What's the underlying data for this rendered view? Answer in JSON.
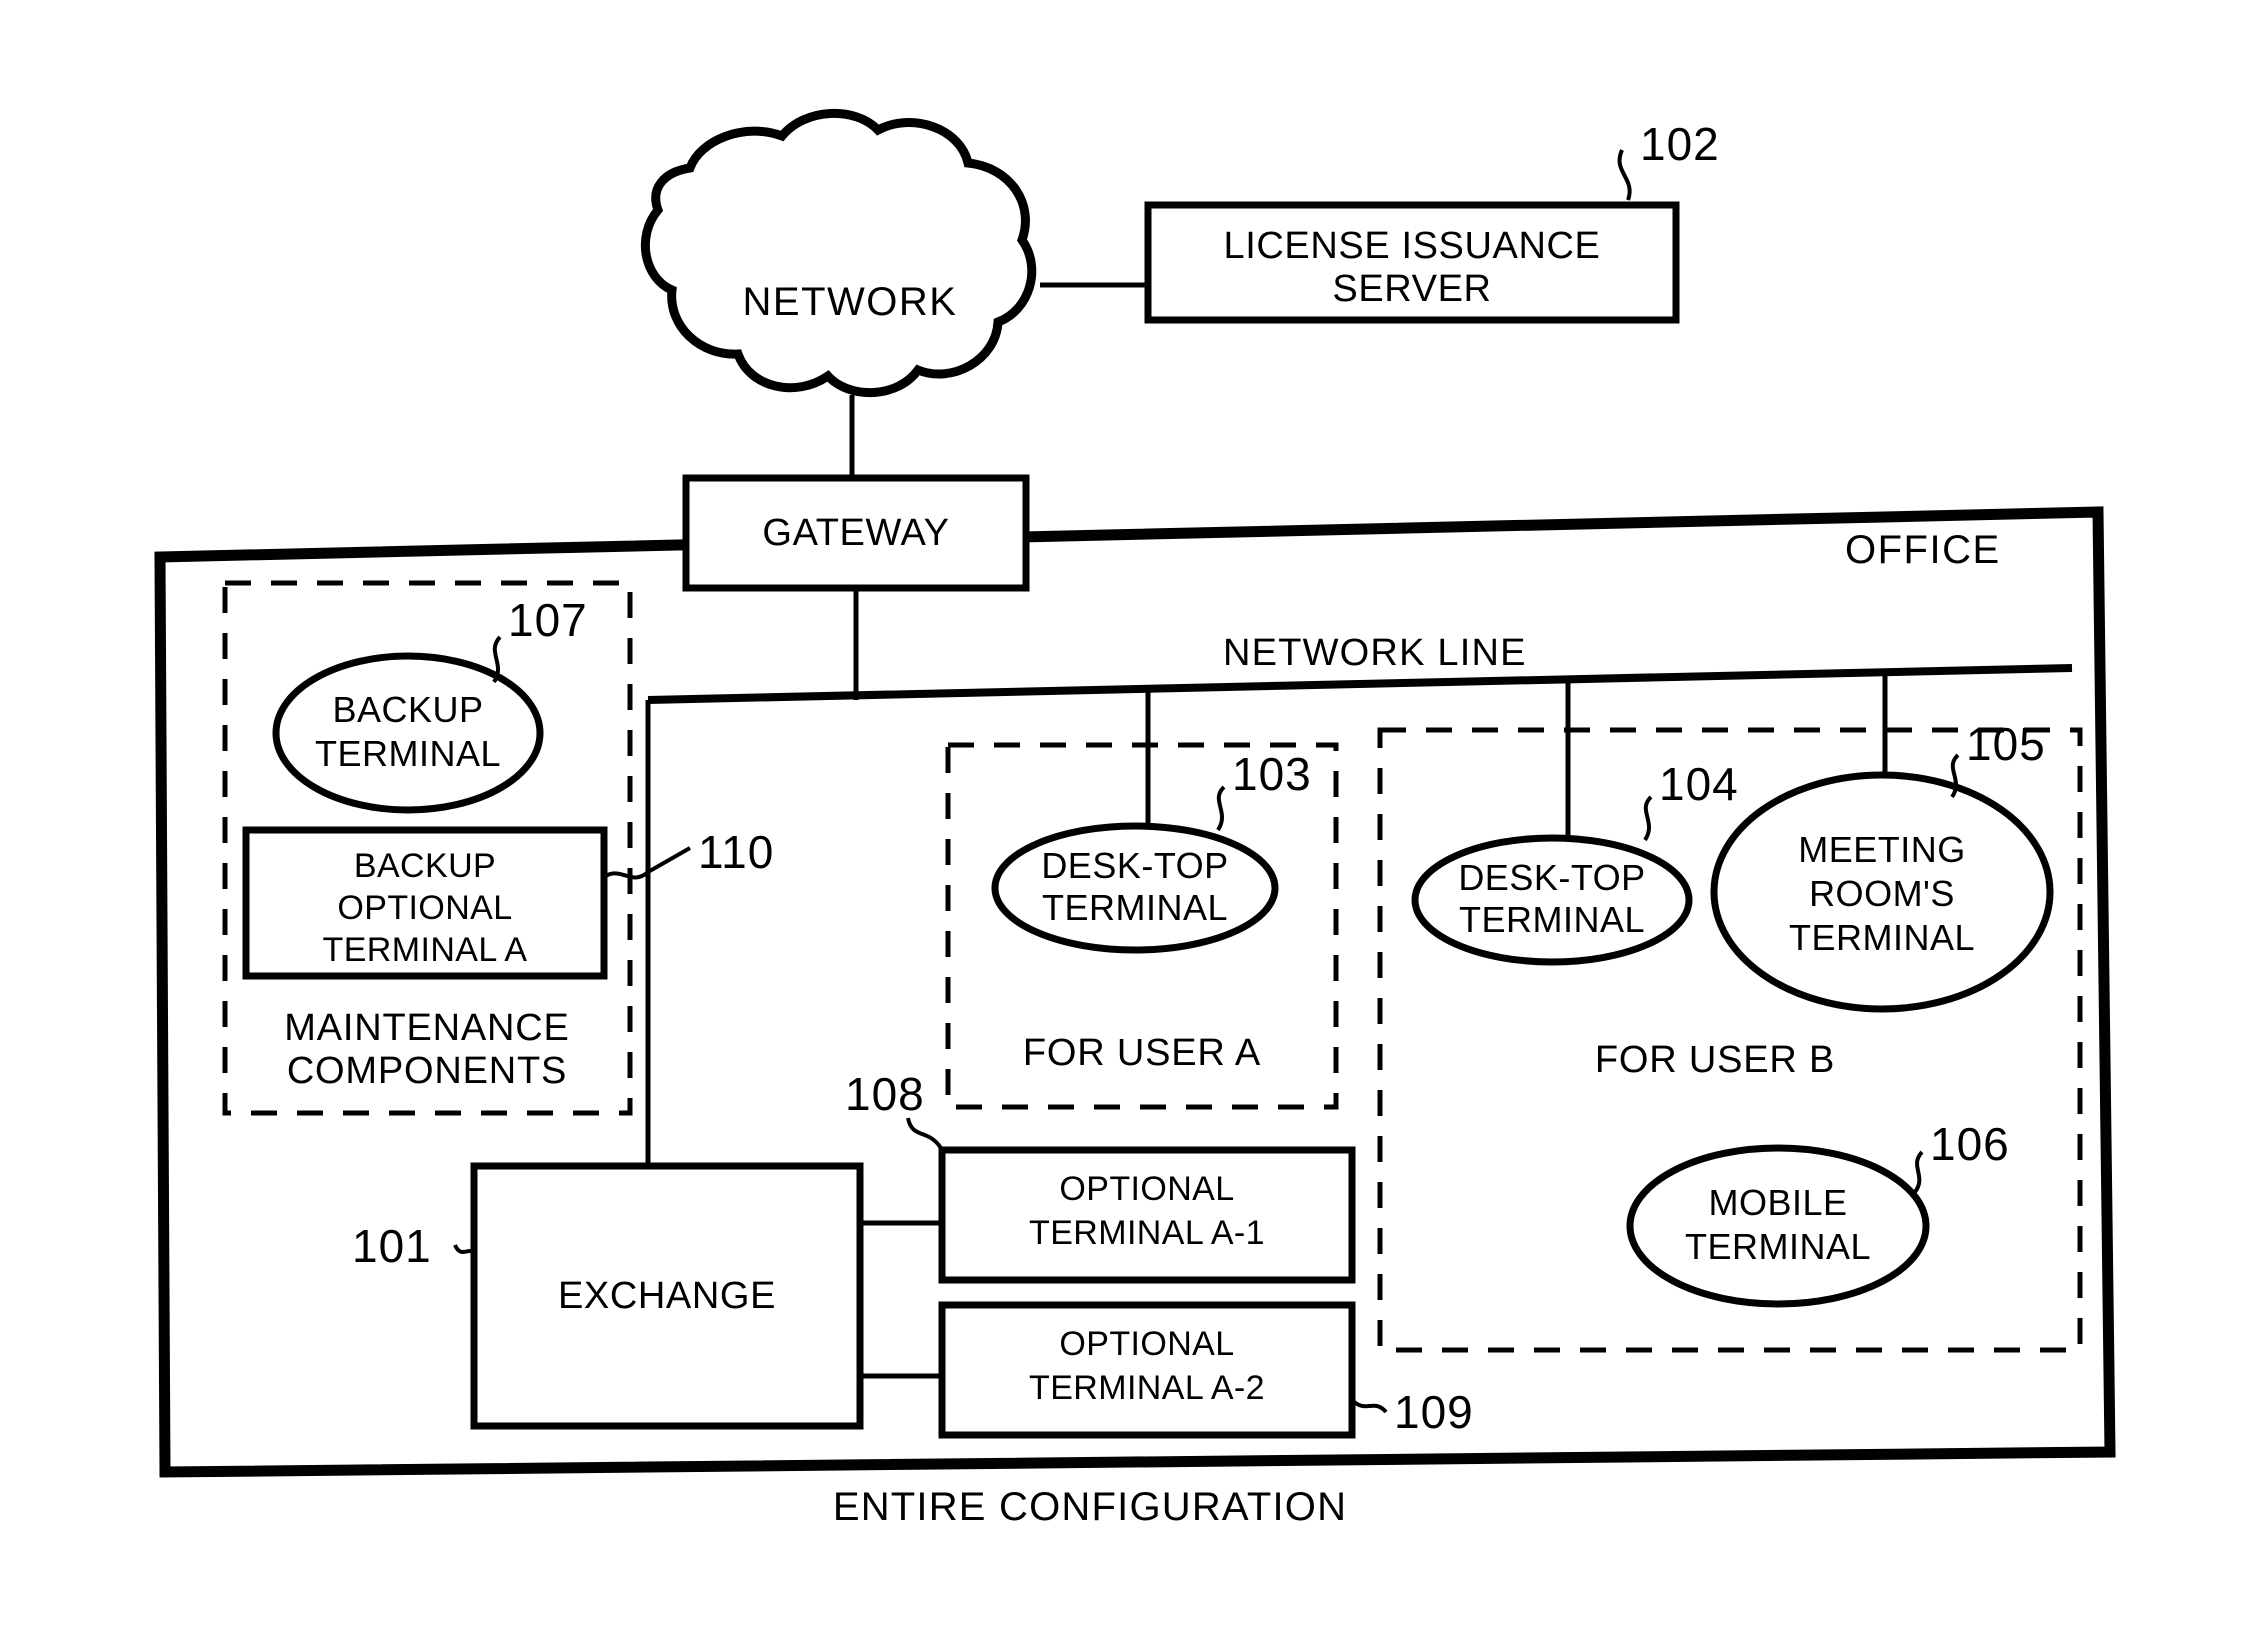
{
  "figure": {
    "caption": "ENTIRE CONFIGURATION",
    "office_label": "OFFICE",
    "network_line_label": "NETWORK LINE"
  },
  "nodes": {
    "network_cloud": {
      "label": "NETWORK"
    },
    "license_server": {
      "label_line1": "LICENSE ISSUANCE",
      "label_line2": "SERVER",
      "ref": "102"
    },
    "gateway": {
      "label": "GATEWAY"
    },
    "exchange": {
      "label": "EXCHANGE",
      "ref": "101"
    },
    "backup_terminal": {
      "label_line1": "BACKUP",
      "label_line2": "TERMINAL",
      "ref": "107"
    },
    "backup_optional_terminal_a": {
      "label_line1": "BACKUP",
      "label_line2": "OPTIONAL",
      "label_line3": "TERMINAL A",
      "ref": "110"
    },
    "desktop_terminal_a": {
      "label_line1": "DESK-TOP",
      "label_line2": "TERMINAL",
      "ref": "103"
    },
    "desktop_terminal_b": {
      "label_line1": "DESK-TOP",
      "label_line2": "TERMINAL",
      "ref": "104"
    },
    "meeting_room_terminal": {
      "label_line1": "MEETING",
      "label_line2": "ROOM'S",
      "label_line3": "TERMINAL",
      "ref": "105"
    },
    "mobile_terminal": {
      "label_line1": "MOBILE",
      "label_line2": "TERMINAL",
      "ref": "106"
    },
    "optional_terminal_a1": {
      "label_line1": "OPTIONAL",
      "label_line2": "TERMINAL A-1",
      "ref": "108"
    },
    "optional_terminal_a2": {
      "label_line1": "OPTIONAL",
      "label_line2": "TERMINAL A-2",
      "ref": "109"
    }
  },
  "regions": {
    "maintenance": {
      "label_line1": "MAINTENANCE",
      "label_line2": "COMPONENTS"
    },
    "user_a": {
      "label": "FOR USER A"
    },
    "user_b": {
      "label": "FOR USER B"
    }
  },
  "colors": {
    "ink": "#000000",
    "paper": "#ffffff"
  },
  "chart_data": {
    "type": "diagram",
    "title": "ENTIRE CONFIGURATION",
    "nodes": [
      {
        "id": "network",
        "label": "NETWORK",
        "shape": "cloud",
        "ref": null
      },
      {
        "id": "license_server",
        "label": "LICENSE ISSUANCE SERVER",
        "shape": "rect",
        "ref": "102"
      },
      {
        "id": "gateway",
        "label": "GATEWAY",
        "shape": "rect",
        "ref": null
      },
      {
        "id": "exchange",
        "label": "EXCHANGE",
        "shape": "rect",
        "ref": "101"
      },
      {
        "id": "backup_terminal",
        "label": "BACKUP TERMINAL",
        "shape": "ellipse",
        "ref": "107"
      },
      {
        "id": "backup_optional_terminal_a",
        "label": "BACKUP OPTIONAL TERMINAL A",
        "shape": "rect",
        "ref": "110"
      },
      {
        "id": "desktop_terminal_a",
        "label": "DESK-TOP TERMINAL",
        "shape": "ellipse",
        "ref": "103"
      },
      {
        "id": "desktop_terminal_b",
        "label": "DESK-TOP TERMINAL",
        "shape": "ellipse",
        "ref": "104"
      },
      {
        "id": "meeting_room_terminal",
        "label": "MEETING ROOM'S TERMINAL",
        "shape": "ellipse",
        "ref": "105"
      },
      {
        "id": "mobile_terminal",
        "label": "MOBILE TERMINAL",
        "shape": "ellipse",
        "ref": "106"
      },
      {
        "id": "optional_terminal_a1",
        "label": "OPTIONAL TERMINAL A-1",
        "shape": "rect",
        "ref": "108"
      },
      {
        "id": "optional_terminal_a2",
        "label": "OPTIONAL TERMINAL A-2",
        "shape": "rect",
        "ref": "109"
      }
    ],
    "edges": [
      {
        "from": "network",
        "to": "license_server"
      },
      {
        "from": "network",
        "to": "gateway"
      },
      {
        "from": "gateway",
        "to": "network_line"
      },
      {
        "from": "network_line",
        "to": "desktop_terminal_a"
      },
      {
        "from": "network_line",
        "to": "desktop_terminal_b"
      },
      {
        "from": "network_line",
        "to": "meeting_room_terminal"
      },
      {
        "from": "network_line",
        "to": "exchange"
      },
      {
        "from": "exchange",
        "to": "optional_terminal_a1"
      },
      {
        "from": "exchange",
        "to": "optional_terminal_a2"
      }
    ],
    "groups": [
      {
        "label": "OFFICE",
        "style": "solid-thick",
        "members": [
          "gateway",
          "exchange",
          "backup_terminal",
          "backup_optional_terminal_a",
          "desktop_terminal_a",
          "desktop_terminal_b",
          "meeting_room_terminal",
          "mobile_terminal",
          "optional_terminal_a1",
          "optional_terminal_a2"
        ]
      },
      {
        "label": "MAINTENANCE COMPONENTS",
        "style": "dashed",
        "members": [
          "backup_terminal",
          "backup_optional_terminal_a"
        ]
      },
      {
        "label": "FOR USER A",
        "style": "dashed",
        "members": [
          "desktop_terminal_a"
        ]
      },
      {
        "label": "FOR USER B",
        "style": "dashed",
        "members": [
          "desktop_terminal_b",
          "meeting_room_terminal",
          "mobile_terminal"
        ]
      }
    ],
    "annotations": [
      "NETWORK LINE",
      "ENTIRE CONFIGURATION"
    ]
  }
}
